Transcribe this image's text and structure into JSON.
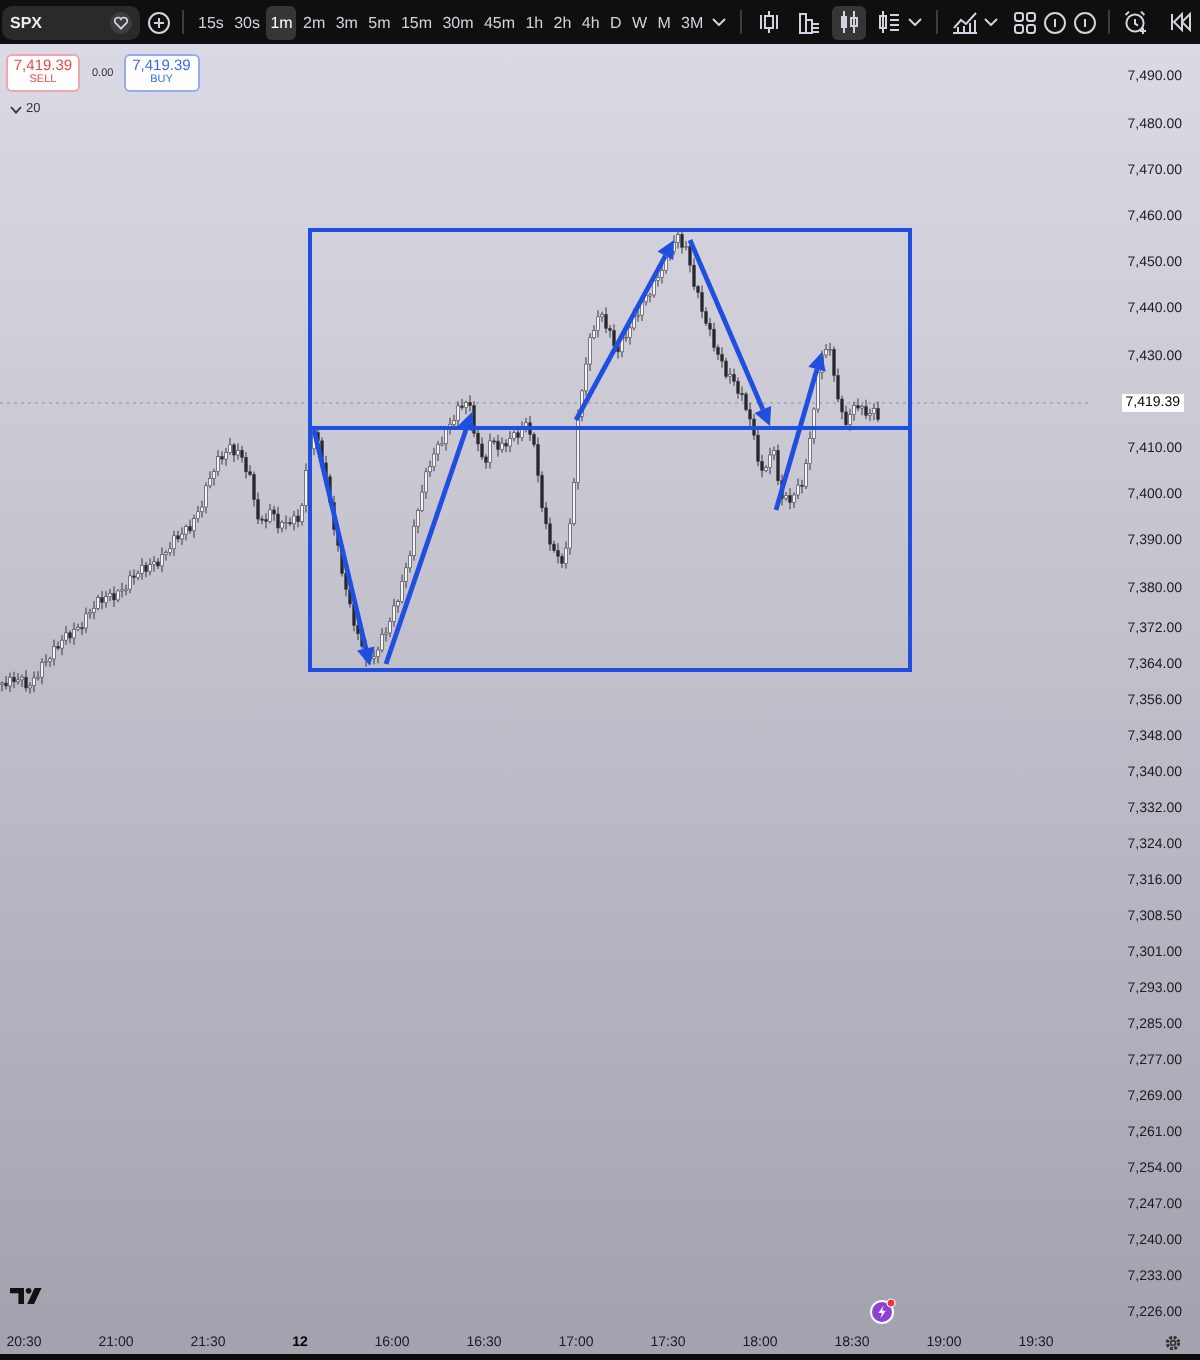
{
  "toolbar": {
    "symbol": "SPX",
    "intervals": [
      {
        "label": "15s",
        "selected": false
      },
      {
        "label": "30s",
        "selected": false
      },
      {
        "label": "1m",
        "selected": true
      },
      {
        "label": "2m",
        "selected": false
      },
      {
        "label": "3m",
        "selected": false
      },
      {
        "label": "5m",
        "selected": false
      },
      {
        "label": "15m",
        "selected": false
      },
      {
        "label": "30m",
        "selected": false
      },
      {
        "label": "45m",
        "selected": false
      },
      {
        "label": "1h",
        "selected": false
      },
      {
        "label": "2h",
        "selected": false
      },
      {
        "label": "4h",
        "selected": false
      },
      {
        "label": "D",
        "selected": false
      },
      {
        "label": "W",
        "selected": false
      },
      {
        "label": "M",
        "selected": false
      },
      {
        "label": "3M",
        "selected": false
      }
    ],
    "chart_styles": [
      {
        "kind": "hollow",
        "selected": false
      },
      {
        "kind": "columns",
        "selected": false
      },
      {
        "kind": "candles",
        "selected": true
      },
      {
        "kind": "lines",
        "selected": false
      }
    ]
  },
  "order_panel": {
    "sell": {
      "price": "7,419.39",
      "label": "SELL"
    },
    "spread": "0.00",
    "buy": {
      "price": "7,419.39",
      "label": "BUY"
    }
  },
  "legend": {
    "value": "20"
  },
  "price_axis": [
    {
      "text": "7,490.00",
      "current": false
    },
    {
      "text": "7,480.00",
      "current": false
    },
    {
      "text": "7,470.00",
      "current": false
    },
    {
      "text": "7,460.00",
      "current": false
    },
    {
      "text": "7,450.00",
      "current": false
    },
    {
      "text": "7,440.00",
      "current": false
    },
    {
      "text": "7,430.00",
      "current": false
    },
    {
      "text": "7,419.39",
      "current": true
    },
    {
      "text": "7,410.00",
      "current": false
    },
    {
      "text": "7,400.00",
      "current": false
    },
    {
      "text": "7,390.00",
      "current": false
    },
    {
      "text": "7,380.00",
      "current": false
    },
    {
      "text": "7,372.00",
      "current": false
    },
    {
      "text": "7,364.00",
      "current": false
    },
    {
      "text": "7,356.00",
      "current": false
    },
    {
      "text": "7,348.00",
      "current": false
    },
    {
      "text": "7,340.00",
      "current": false
    },
    {
      "text": "7,332.00",
      "current": false
    },
    {
      "text": "7,324.00",
      "current": false
    },
    {
      "text": "7,316.00",
      "current": false
    },
    {
      "text": "7,308.50",
      "current": false
    },
    {
      "text": "7,301.00",
      "current": false
    },
    {
      "text": "7,293.00",
      "current": false
    },
    {
      "text": "7,285.00",
      "current": false
    },
    {
      "text": "7,277.00",
      "current": false
    },
    {
      "text": "7,269.00",
      "current": false
    },
    {
      "text": "7,261.00",
      "current": false
    },
    {
      "text": "7,254.00",
      "current": false
    },
    {
      "text": "7,247.00",
      "current": false
    },
    {
      "text": "7,240.00",
      "current": false
    },
    {
      "text": "7,233.00",
      "current": false
    },
    {
      "text": "7,226.00",
      "current": false
    }
  ],
  "time_axis": [
    {
      "text": "20:30",
      "kind": "time"
    },
    {
      "text": "21:00",
      "kind": "time"
    },
    {
      "text": "21:30",
      "kind": "time"
    },
    {
      "text": "12",
      "kind": "day"
    },
    {
      "text": "16:00",
      "kind": "time"
    },
    {
      "text": "16:30",
      "kind": "time"
    },
    {
      "text": "17:00",
      "kind": "time"
    },
    {
      "text": "17:30",
      "kind": "time"
    },
    {
      "text": "18:00",
      "kind": "time"
    },
    {
      "text": "18:30",
      "kind": "time"
    },
    {
      "text": "19:00",
      "kind": "time"
    },
    {
      "text": "19:30",
      "kind": "time"
    }
  ]
}
